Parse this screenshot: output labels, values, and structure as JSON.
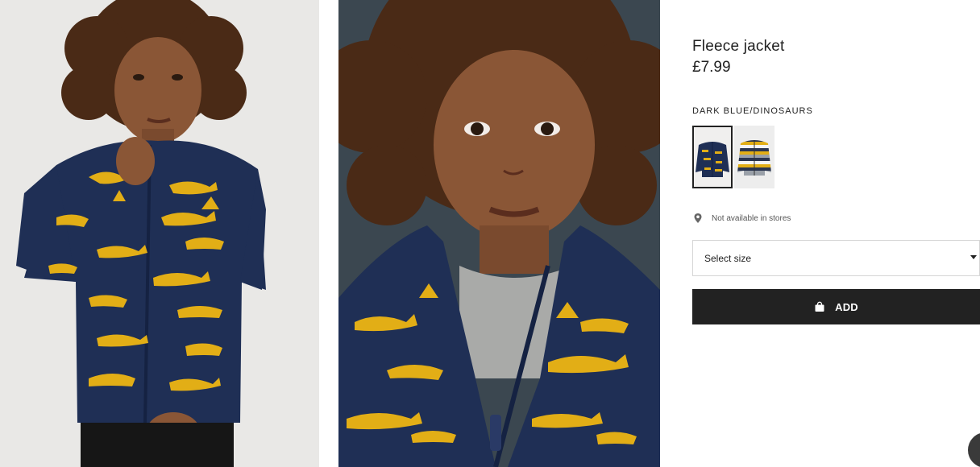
{
  "product": {
    "title": "Fleece jacket",
    "price": "£7.99",
    "color_name": "DARK BLUE/DINOSAURS"
  },
  "swatches": [
    {
      "label": "Dark blue/Dinosaurs",
      "selected": true,
      "pattern": "dinosaurs"
    },
    {
      "label": "Striped",
      "selected": false,
      "pattern": "stripes"
    }
  ],
  "availability": {
    "icon": "location-pin-icon",
    "text": "Not available in stores"
  },
  "size_select": {
    "placeholder": "Select size",
    "icon": "caret-down-icon"
  },
  "add_button": {
    "label": "ADD",
    "icon": "shopping-bag-icon"
  },
  "colors": {
    "navy": "#1f2f55",
    "mustard": "#e2ae16",
    "button": "#222222",
    "photo_bg_1": "#e9e8e6",
    "photo_bg_2": "#3b4750"
  }
}
